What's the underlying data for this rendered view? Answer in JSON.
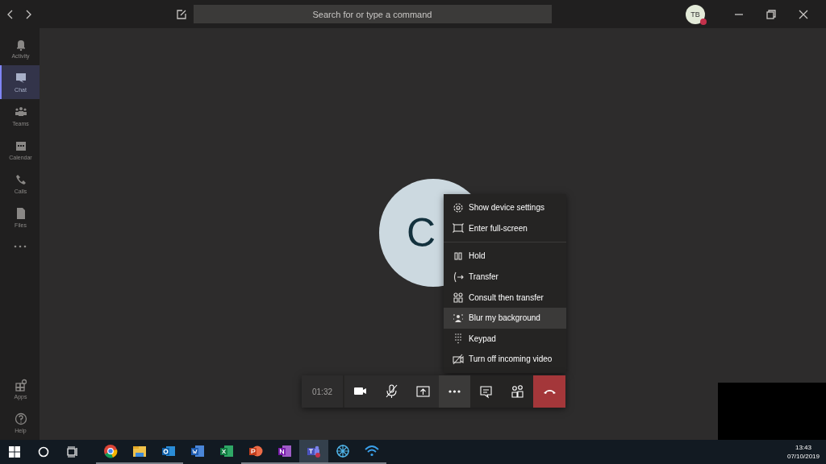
{
  "title_bar": {
    "search": {
      "placeholder": "Search for or type a command"
    },
    "avatar": {
      "initials": "TB",
      "busy": true
    }
  },
  "sidebar": {
    "items": [
      {
        "kind": "activity",
        "label": "Activity",
        "selected": false
      },
      {
        "kind": "chat",
        "label": "Chat",
        "selected": true
      },
      {
        "kind": "teams",
        "label": "Teams",
        "selected": false
      },
      {
        "kind": "calendar",
        "label": "Calendar",
        "selected": false
      },
      {
        "kind": "calls",
        "label": "Calls",
        "selected": false
      },
      {
        "kind": "files",
        "label": "Files",
        "selected": false
      }
    ],
    "bottom_items": [
      {
        "kind": "apps",
        "label": "Apps",
        "selected": false
      },
      {
        "kind": "help",
        "label": "Help",
        "selected": false
      }
    ]
  },
  "call": {
    "caller_initials": "C",
    "menu": {
      "sections": [
        [
          {
            "kind": "gear",
            "label": "Show device settings",
            "selected": false
          },
          {
            "kind": "fullscreen",
            "label": "Enter full-screen",
            "selected": false
          }
        ],
        [
          {
            "kind": "hold",
            "label": "Hold",
            "selected": false
          },
          {
            "kind": "transfer",
            "label": "Transfer",
            "selected": false
          },
          {
            "kind": "consult",
            "label": "Consult then transfer",
            "selected": false
          },
          {
            "kind": "blur",
            "label": "Blur my background",
            "selected": true
          },
          {
            "kind": "keypad",
            "label": "Keypad",
            "selected": false
          },
          {
            "kind": "video-off",
            "label": "Turn off incoming video",
            "selected": false
          }
        ]
      ]
    },
    "controls": {
      "timer": "01:32",
      "buttons": [
        {
          "kind": "camera",
          "selected": false
        },
        {
          "kind": "mic-off",
          "selected": false
        },
        {
          "kind": "share",
          "selected": false
        },
        {
          "kind": "more",
          "selected": true
        },
        {
          "kind": "chat",
          "selected": false
        },
        {
          "kind": "people",
          "selected": false
        },
        {
          "kind": "hangup",
          "selected": false
        }
      ]
    }
  },
  "taskbar": {
    "apps": [
      {
        "kind": "chrome",
        "running": true,
        "selected": false
      },
      {
        "kind": "explorer",
        "running": true,
        "selected": false
      },
      {
        "kind": "outlook",
        "running": true,
        "selected": false
      },
      {
        "kind": "word",
        "running": false,
        "selected": false
      },
      {
        "kind": "excel",
        "running": false,
        "selected": false
      },
      {
        "kind": "powerpoint",
        "running": true,
        "selected": false
      },
      {
        "kind": "onenote",
        "running": true,
        "selected": false
      },
      {
        "kind": "teams",
        "running": true,
        "selected": true
      },
      {
        "kind": "globe",
        "running": true,
        "selected": false
      },
      {
        "kind": "wifi",
        "running": true,
        "selected": false
      }
    ],
    "time": "13:43",
    "date": "07/10/2019"
  }
}
